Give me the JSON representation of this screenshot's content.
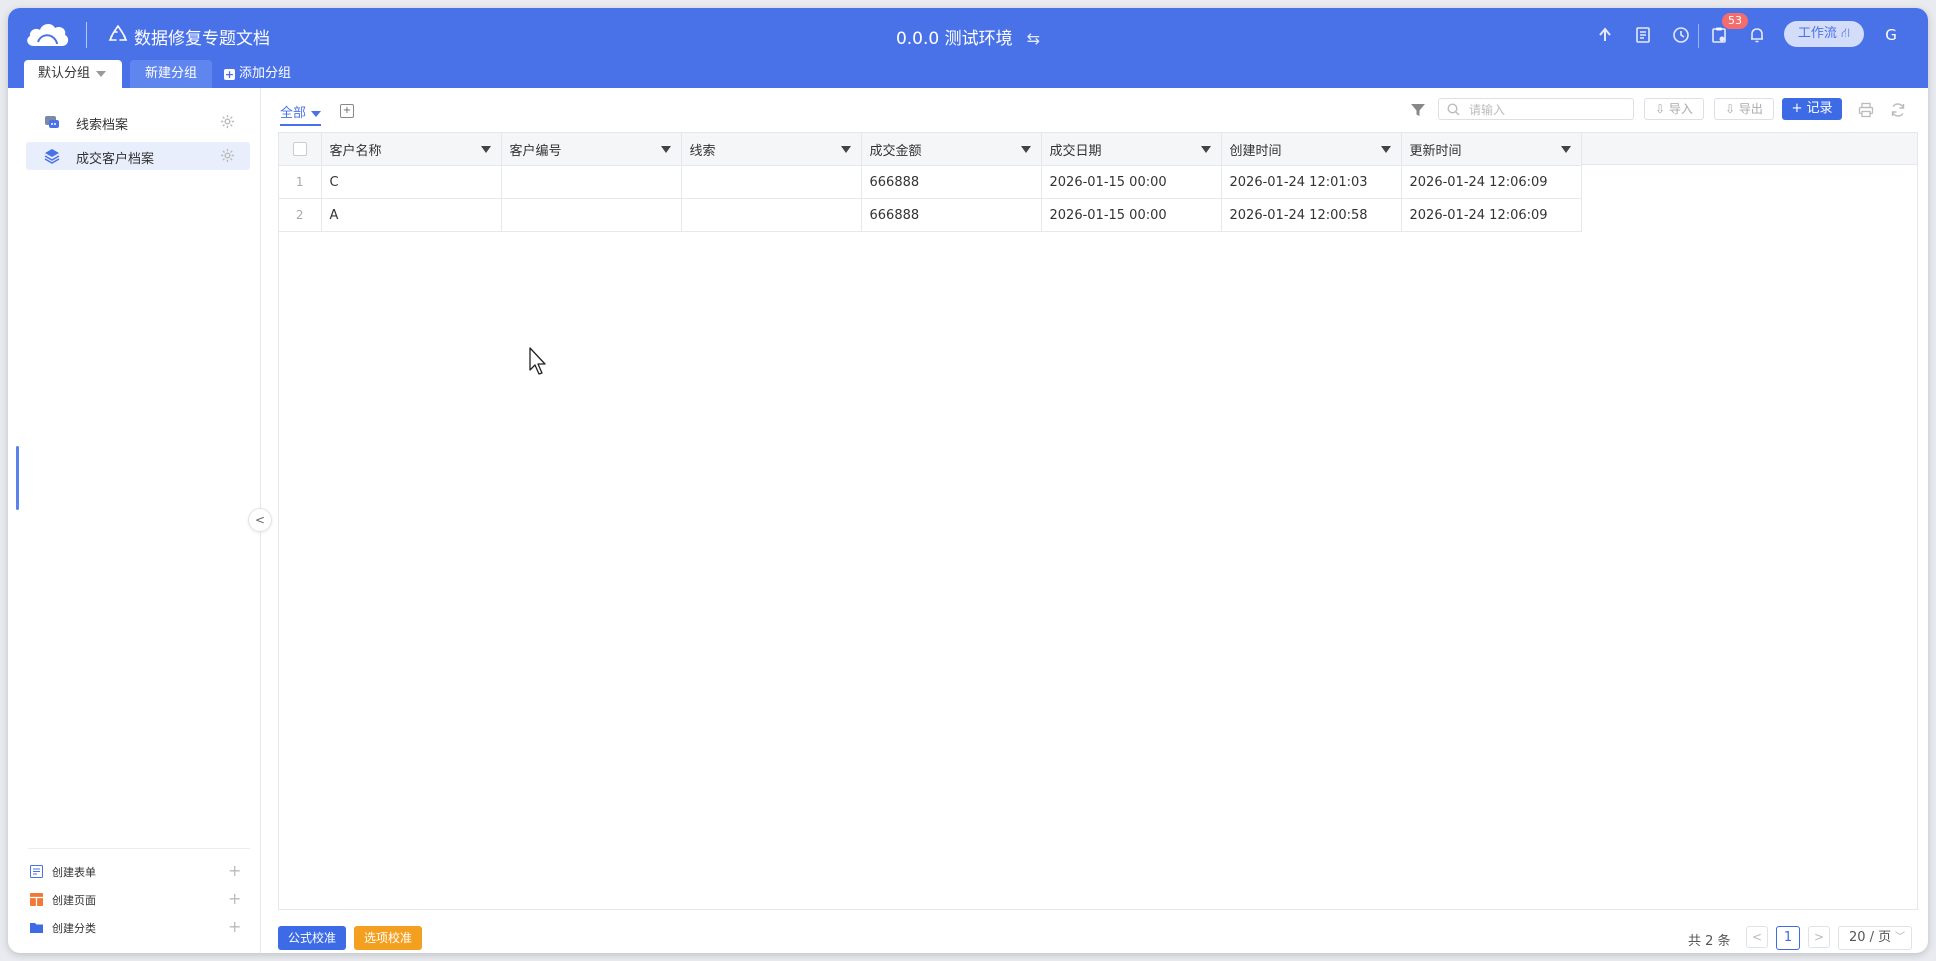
{
  "app": {
    "title": "数据修复专题文档",
    "environment": "0.0.0 测试环境",
    "swap_glyph": "⇆",
    "notification_count": "53",
    "workflow_label": "工作流 ⛙",
    "avatar_letter": "G",
    "accent_color": "#4a72e8"
  },
  "groups": {
    "tabs": [
      {
        "label": "默认分组"
      },
      {
        "label": "新建分组"
      }
    ],
    "add_label": "添加分组"
  },
  "sidebar": {
    "items": [
      {
        "label": "线索档案",
        "icon": "chat-icon"
      },
      {
        "label": "成交客户档案",
        "icon": "layers-icon",
        "selected": true
      }
    ],
    "create": [
      {
        "label": "创建表单",
        "icon": "form-icon"
      },
      {
        "label": "创建页面",
        "icon": "page-icon"
      },
      {
        "label": "创建分类",
        "icon": "folder-icon"
      }
    ],
    "collapse_glyph": "<"
  },
  "toolbar": {
    "view_tab": "全部",
    "search_placeholder": "请输入",
    "import_label": "⇩ 导入",
    "export_label": "⇩ 导出",
    "record_label": "+ 记录"
  },
  "table": {
    "columns": [
      "客户名称",
      "客户编号",
      "线索",
      "成交金额",
      "成交日期",
      "创建时间",
      "更新时间"
    ],
    "rows": [
      {
        "index": "1",
        "cells": [
          "C",
          "",
          "",
          "666888",
          "2026-01-15 00:00",
          "2026-01-24 12:01:03",
          "2026-01-24 12:06:09"
        ]
      },
      {
        "index": "2",
        "cells": [
          "A",
          "",
          "",
          "666888",
          "2026-01-15 00:00",
          "2026-01-24 12:00:58",
          "2026-01-24 12:06:09"
        ]
      }
    ]
  },
  "footer": {
    "formula_check": "公式校准",
    "option_check": "选项校准",
    "total": "共 2 条",
    "current_page": "1",
    "page_size": "20 / 页",
    "prev_glyph": "<",
    "next_glyph": ">"
  }
}
